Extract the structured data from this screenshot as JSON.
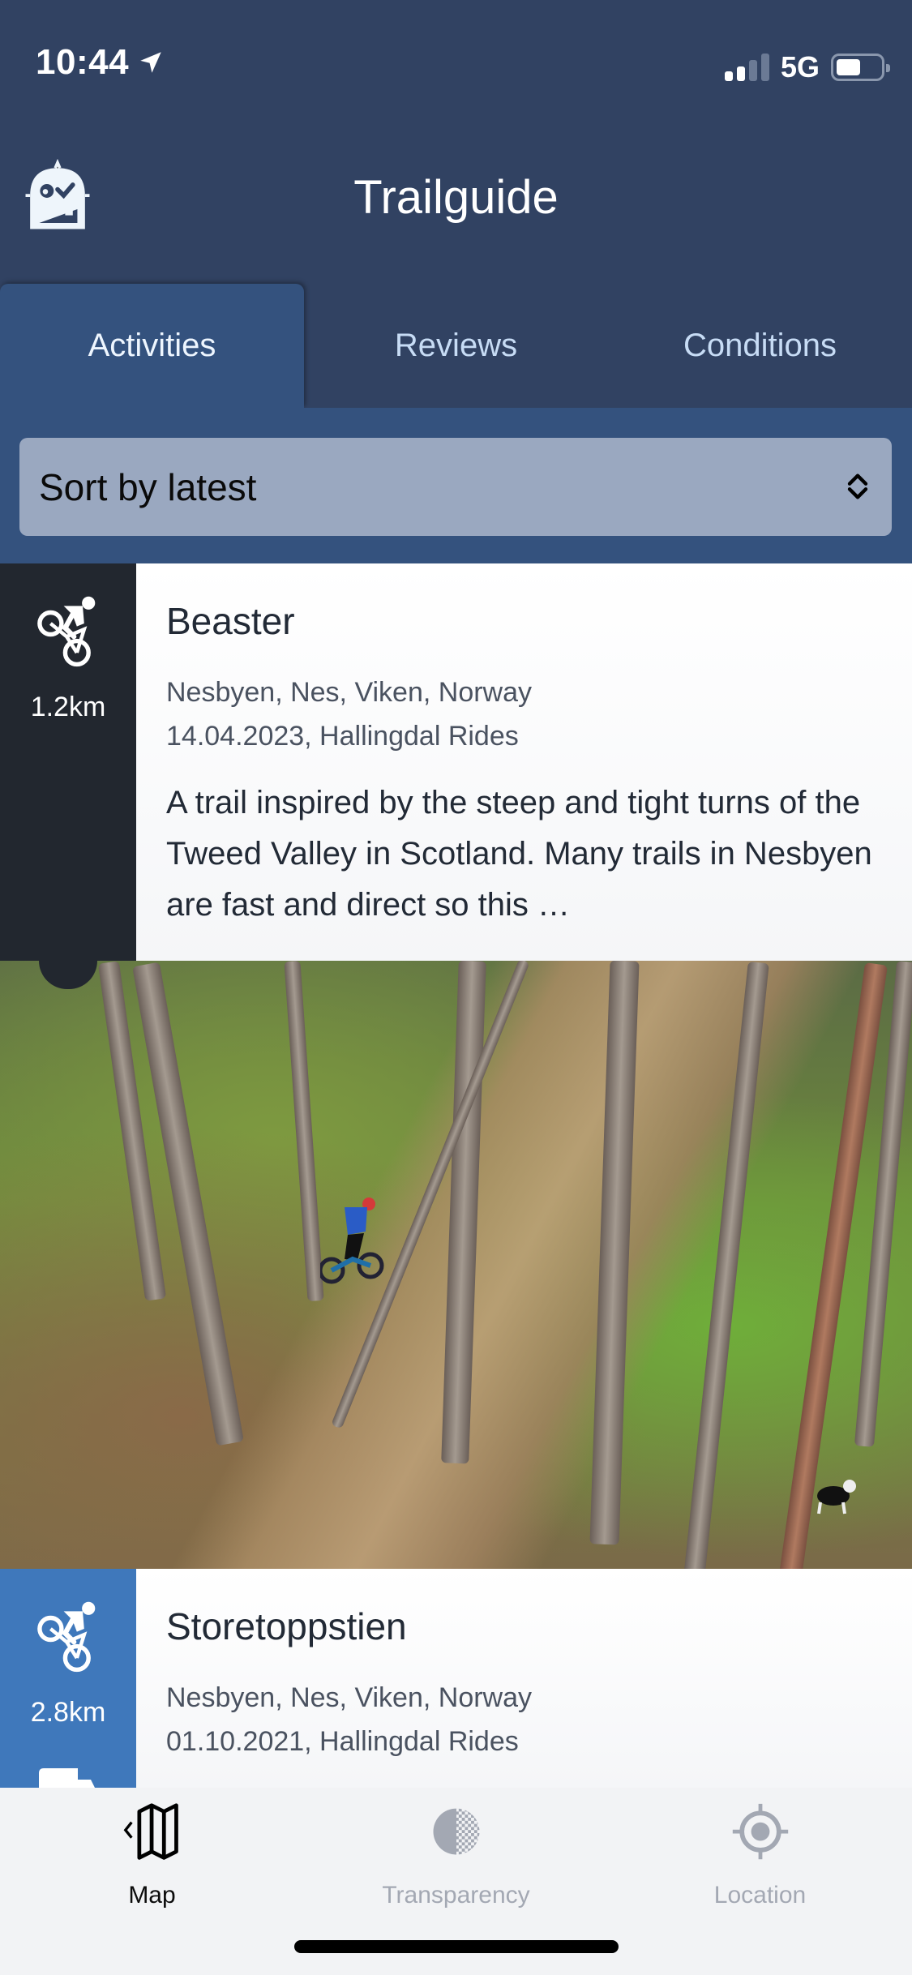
{
  "status_bar": {
    "time": "10:44",
    "network": "5G",
    "signal_bars_active": 2,
    "signal_bars_total": 4,
    "battery_level": 0.55
  },
  "header": {
    "title": "Trailguide",
    "logo_icon": "trailguide-logo-icon"
  },
  "tabs": [
    {
      "label": "Activities",
      "active": true
    },
    {
      "label": "Reviews",
      "active": false
    },
    {
      "label": "Conditions",
      "active": false
    }
  ],
  "sort": {
    "selected": "Sort by latest",
    "icon": "chevron-updown-icon"
  },
  "cards": [
    {
      "activity_icon": "mountain-bike-icon",
      "distance": "1.2km",
      "title": "Beaster",
      "location": "Nesbyen, Nes, Viken, Norway",
      "date_author": "14.04.2023, Hallingdal Rides",
      "description": "A trail inspired by the steep and tight turns of the Tweed Valley in Scotland. Many trails in Nesbyen are fast and direct so this …",
      "side_color": "#22272f",
      "has_photo": true
    },
    {
      "activity_icon": "mountain-bike-icon",
      "distance": "2.8km",
      "title": "Storetoppstien",
      "location": "Nesbyen, Nes, Viken, Norway",
      "date_author": "01.10.2021, Hallingdal Rides",
      "side_color": "#3f78bb",
      "secondary_icon": "shuttle-icon"
    }
  ],
  "bottom_nav": [
    {
      "label": "Map",
      "icon": "map-back-icon",
      "active": true
    },
    {
      "label": "Transparency",
      "icon": "transparency-icon",
      "active": false
    },
    {
      "label": "Location",
      "icon": "location-target-icon",
      "active": false
    }
  ],
  "colors": {
    "header_bg": "#314262",
    "active_tab_bg": "#34527e",
    "select_bg": "#9aa8c0",
    "nav_bg": "#f2f3f5",
    "inactive_nav": "#a3a8b3"
  }
}
